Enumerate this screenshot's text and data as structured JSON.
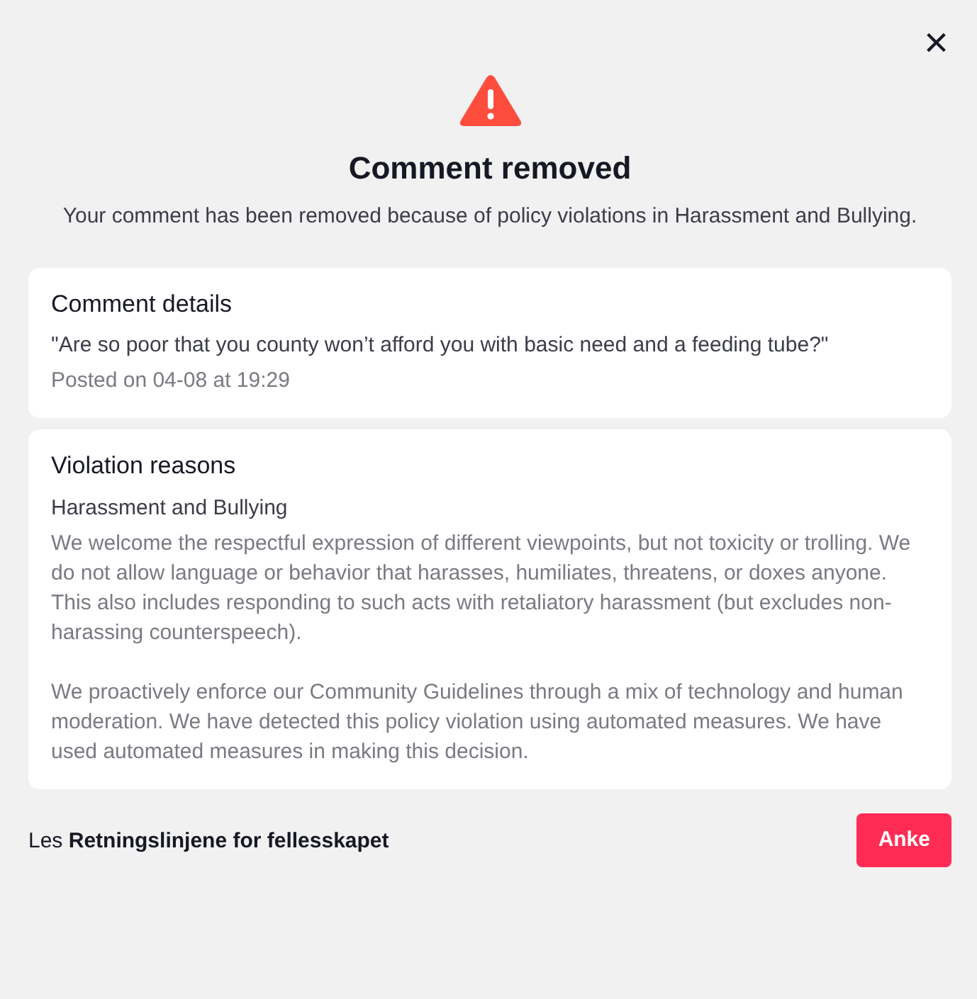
{
  "close_button": {
    "label": "×"
  },
  "title": "Comment removed",
  "subtitle": "Your comment has been removed because of policy violations in Harassment and Bullying.",
  "comment_card": {
    "heading": "Comment details",
    "comment": "\"Are so poor that you county won’t afford you with basic need and a feeding tube?\"",
    "posted": "Posted on 04-08 at 19:29"
  },
  "violation_card": {
    "heading": "Violation reasons",
    "category": "Harassment and Bullying",
    "paragraphs": [
      "We welcome the respectful expression of different viewpoints, but not toxicity or trolling. We do not allow language or behavior that harasses, humiliates, threatens, or doxes anyone. This also includes responding to such acts with retaliatory harassment (but excludes non-harassing counterspeech).",
      "We proactively enforce our Community Guidelines through a mix of technology and human moderation. We have detected this policy violation using automated measures. We have used automated measures in making this decision."
    ]
  },
  "footer": {
    "prefix": "Les",
    "link": "Retningslinjene for fellesskapet",
    "button": "Anke"
  }
}
